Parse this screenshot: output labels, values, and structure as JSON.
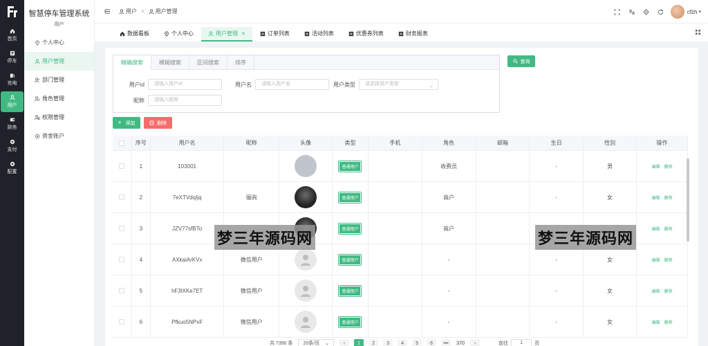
{
  "app": {
    "title": "智慧停车管理系统",
    "subtitle": "用户"
  },
  "rail": {
    "items": [
      {
        "label": "首页",
        "icon": "home-icon",
        "active": false
      },
      {
        "label": "停车",
        "icon": "parking-icon",
        "active": false
      },
      {
        "label": "充电",
        "icon": "charging-icon",
        "active": false
      },
      {
        "label": "用户",
        "icon": "user-icon",
        "active": true
      },
      {
        "label": "财务",
        "icon": "finance-icon",
        "active": false
      },
      {
        "label": "支付",
        "icon": "pay-icon",
        "active": false
      },
      {
        "label": "配置",
        "icon": "config-icon",
        "active": false
      }
    ]
  },
  "sidebar": {
    "items": [
      {
        "label": "个人中心",
        "icon": "location-icon",
        "active": false
      },
      {
        "label": "用户管理",
        "icon": "user-icon",
        "active": true
      },
      {
        "label": "部门管理",
        "icon": "department-icon",
        "active": false
      },
      {
        "label": "角色管理",
        "icon": "role-icon",
        "active": false
      },
      {
        "label": "权限管理",
        "icon": "permission-icon",
        "active": false
      },
      {
        "label": "资金账户",
        "icon": "account-icon",
        "active": false
      }
    ]
  },
  "header": {
    "breadcrumb": [
      "用户",
      "用户管理"
    ],
    "username": "cfzh"
  },
  "tabs": [
    {
      "label": "数据看板",
      "icon": "home-icon",
      "active": false,
      "closable": false
    },
    {
      "label": "个人中心",
      "icon": "location-icon",
      "active": false,
      "closable": false
    },
    {
      "label": "用户管理",
      "icon": "user-icon",
      "active": true,
      "closable": true
    },
    {
      "label": "订单列表",
      "icon": "list-icon",
      "active": false,
      "closable": false
    },
    {
      "label": "活动列表",
      "icon": "list-icon",
      "active": false,
      "closable": false
    },
    {
      "label": "优惠券列表",
      "icon": "list-icon",
      "active": false,
      "closable": false
    },
    {
      "label": "财务报表",
      "icon": "list-icon",
      "active": false,
      "closable": false
    }
  ],
  "search": {
    "tabs": [
      "精确搜索",
      "模糊搜索",
      "区间搜索",
      "排序"
    ],
    "active_tab": 0,
    "fields": {
      "userid": {
        "label": "用户id",
        "placeholder": "请输入用户id"
      },
      "username": {
        "label": "用户名",
        "placeholder": "请输入用户名"
      },
      "usertype": {
        "label": "用户类型",
        "placeholder": "请选择用户类型"
      },
      "nickname": {
        "label": "昵称",
        "placeholder": "请输入昵称"
      }
    },
    "query_label": "查询"
  },
  "toolbar": {
    "add_label": "添加",
    "delete_label": "删除"
  },
  "table": {
    "headers": [
      "",
      "序号",
      "用户名",
      "昵称",
      "头像",
      "类型",
      "手机",
      "角色",
      "邮箱",
      "生日",
      "性别",
      "操作"
    ],
    "rows": [
      {
        "no": "1",
        "username": "103001",
        "nickname": "",
        "avatar": "grey",
        "type": "普通用户",
        "phone": "",
        "role": "收费员",
        "email": "",
        "birthday": "-",
        "gender": "男"
      },
      {
        "no": "2",
        "username": "7eXTVdqIjq",
        "nickname": "骊驹",
        "avatar": "dark",
        "type": "普通用户",
        "phone": "",
        "role": "商户",
        "email": "",
        "birthday": "-",
        "gender": "女"
      },
      {
        "no": "3",
        "username": "JZV77sfBTo",
        "nickname": "",
        "avatar": "dark",
        "type": "普通用户",
        "phone": "",
        "role": "商户",
        "email": "",
        "birthday": "",
        "gender": ""
      },
      {
        "no": "4",
        "username": "AXkaiArKVx",
        "nickname": "微信用户",
        "avatar": "default",
        "type": "普通用户",
        "phone": "",
        "role": "-",
        "email": "",
        "birthday": "-",
        "gender": "女"
      },
      {
        "no": "5",
        "username": "hF3lXKe7ET",
        "nickname": "微信用户",
        "avatar": "default",
        "type": "普通用户",
        "phone": "",
        "role": "-",
        "email": "",
        "birthday": "-",
        "gender": "女"
      },
      {
        "no": "6",
        "username": "Pfkuo5NPxF",
        "nickname": "微信用户",
        "avatar": "default",
        "type": "普通用户",
        "phone": "",
        "role": "-",
        "email": "",
        "birthday": "-",
        "gender": "女"
      }
    ],
    "actions": {
      "edit": "编辑",
      "delete": "删除"
    }
  },
  "watermark": "梦三年源码网",
  "pagination": {
    "total_text": "共 7390 条",
    "page_size": "20条/页",
    "pages": [
      "1",
      "2",
      "3",
      "4",
      "5",
      "6",
      "•••",
      "370"
    ],
    "current": "1",
    "goto_label": "前往",
    "goto_value": "1",
    "page_unit": "页",
    "prev": "‹",
    "next": "›"
  },
  "colors": {
    "accent": "#42b983",
    "danger": "#f56c6c",
    "rail_bg": "#1f2329"
  }
}
